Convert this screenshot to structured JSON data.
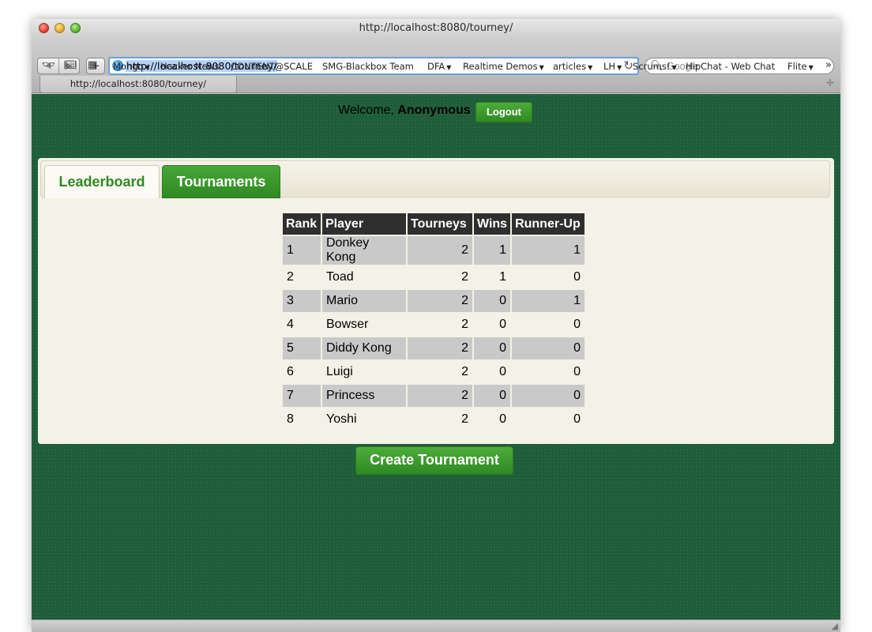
{
  "browser": {
    "window_title": "http://localhost:8080/tourney/",
    "url": "http://localhost:8080/tourney/",
    "search_placeholder": "Google",
    "tab_title": "http://localhost:8080/tourney/",
    "bookmarks": [
      {
        "label": "Mongo",
        "caret": true
      },
      {
        "label": "Hacker News",
        "caret": false
      },
      {
        "label": "CONTENT@SCALE",
        "caret": false
      },
      {
        "label": "SMG-Blackbox Team",
        "caret": false
      },
      {
        "label": "DFA",
        "caret": true
      },
      {
        "label": "Realtime Demos",
        "caret": true
      },
      {
        "label": "articles",
        "caret": true
      },
      {
        "label": "LH",
        "caret": true
      },
      {
        "label": "Scrums!",
        "caret": true
      },
      {
        "label": "HipChat - Web Chat",
        "caret": false
      },
      {
        "label": "Flite",
        "caret": true
      }
    ]
  },
  "header": {
    "welcome_prefix": "Welcome,",
    "username": "Anonymous",
    "logout_label": "Logout"
  },
  "tabs": [
    {
      "label": "Leaderboard",
      "active": true
    },
    {
      "label": "Tournaments",
      "active": false
    }
  ],
  "leaderboard": {
    "columns": [
      "Rank",
      "Player",
      "Tourneys",
      "Wins",
      "Runner-Up"
    ],
    "rows": [
      {
        "rank": "1",
        "player": "Donkey Kong",
        "tourneys": "2",
        "wins": "1",
        "runner_up": "1"
      },
      {
        "rank": "2",
        "player": "Toad",
        "tourneys": "2",
        "wins": "1",
        "runner_up": "0"
      },
      {
        "rank": "3",
        "player": "Mario",
        "tourneys": "2",
        "wins": "0",
        "runner_up": "1"
      },
      {
        "rank": "4",
        "player": "Bowser",
        "tourneys": "2",
        "wins": "0",
        "runner_up": "0"
      },
      {
        "rank": "5",
        "player": "Diddy Kong",
        "tourneys": "2",
        "wins": "0",
        "runner_up": "0"
      },
      {
        "rank": "6",
        "player": "Luigi",
        "tourneys": "2",
        "wins": "0",
        "runner_up": "0"
      },
      {
        "rank": "7",
        "player": "Princess",
        "tourneys": "2",
        "wins": "0",
        "runner_up": "0"
      },
      {
        "rank": "8",
        "player": "Yoshi",
        "tourneys": "2",
        "wins": "0",
        "runner_up": "0"
      }
    ]
  },
  "actions": {
    "create_label": "Create Tournament"
  },
  "colors": {
    "accent_green": "#2f8a22",
    "page_background": "#1f5e3a",
    "panel_background": "#f4f1e6",
    "header_row": "#2f2f2f",
    "stripe_row": "#c9c9c9"
  }
}
